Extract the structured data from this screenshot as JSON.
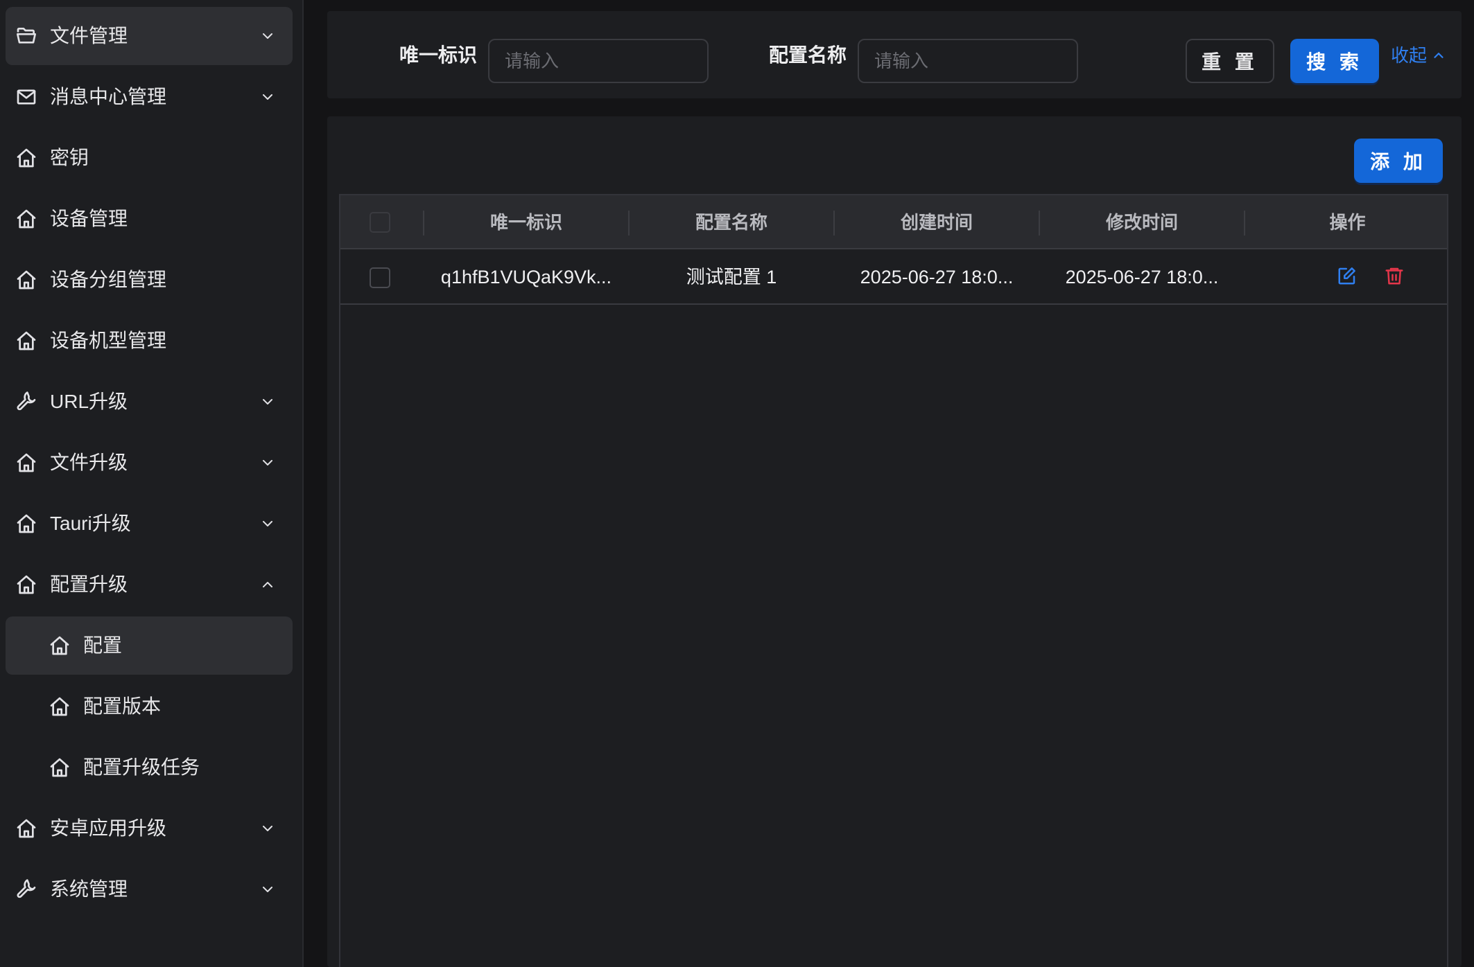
{
  "sidebar": {
    "items": [
      {
        "label": "文件管理",
        "icon": "folder-open-icon"
      },
      {
        "label": "消息中心管理",
        "icon": "mail-icon"
      },
      {
        "label": "密钥",
        "icon": "home-icon"
      },
      {
        "label": "设备管理",
        "icon": "home-icon"
      },
      {
        "label": "设备分组管理",
        "icon": "home-icon"
      },
      {
        "label": "设备机型管理",
        "icon": "home-icon"
      },
      {
        "label": "URL升级",
        "icon": "wrench-icon"
      },
      {
        "label": "文件升级",
        "icon": "home-icon"
      },
      {
        "label": "Tauri升级",
        "icon": "home-icon"
      },
      {
        "label": "配置升级",
        "icon": "home-icon",
        "expanded": true
      },
      {
        "label": "配置",
        "icon": "home-icon",
        "selected": true
      },
      {
        "label": "配置版本",
        "icon": "home-icon"
      },
      {
        "label": "配置升级任务",
        "icon": "home-icon"
      },
      {
        "label": "安卓应用升级",
        "icon": "home-icon"
      },
      {
        "label": "系统管理",
        "icon": "wrench-icon"
      }
    ]
  },
  "search": {
    "id_label": "唯一标识",
    "id_placeholder": "请输入",
    "name_label": "配置名称",
    "name_placeholder": "请输入",
    "reset_label": "重 置",
    "search_label": "搜 索",
    "collapse_label": "收起"
  },
  "toolbar": {
    "add_label": "添 加"
  },
  "table": {
    "columns": [
      "唯一标识",
      "配置名称",
      "创建时间",
      "修改时间",
      "操作"
    ],
    "rows": [
      {
        "id": "q1hfB1VUQaK9Vk...",
        "name": "测试配置 1",
        "created": "2025-06-27 18:0...",
        "modified": "2025-06-27 18:0..."
      }
    ]
  },
  "colors": {
    "primary": "#1467d8",
    "link": "#2f7ff0",
    "edit_icon": "#2f7ff0",
    "delete_icon": "#e5364a",
    "sidebar_bg": "#1d1e21",
    "page_bg": "#141416"
  }
}
